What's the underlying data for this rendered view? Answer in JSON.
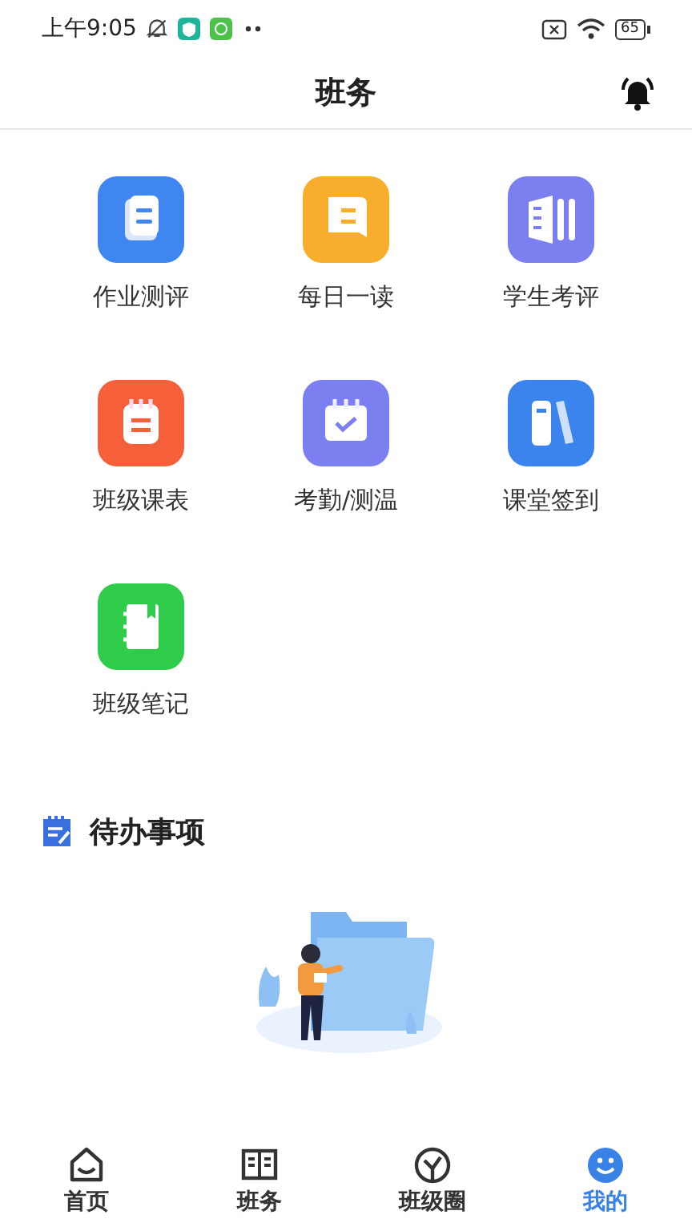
{
  "status_bar": {
    "time": "上午9:05",
    "battery": "65"
  },
  "header": {
    "title": "班务"
  },
  "features": [
    {
      "label": "作业测评",
      "kind": "doc",
      "color": "#3f86f0"
    },
    {
      "label": "每日一读",
      "kind": "book",
      "color": "#f8ad2c"
    },
    {
      "label": "学生考评",
      "kind": "bars",
      "color": "#7b7ff0"
    },
    {
      "label": "班级课表",
      "kind": "calendar",
      "color": "#f5603a"
    },
    {
      "label": "考勤/测温",
      "kind": "check",
      "color": "#7b7ff0"
    },
    {
      "label": "课堂签到",
      "kind": "books",
      "color": "#3b84ee"
    },
    {
      "label": "班级笔记",
      "kind": "notebook",
      "color": "#2fcb4a"
    }
  ],
  "todo": {
    "title": "待办事项"
  },
  "tabs": [
    {
      "label": "首页",
      "kind": "home",
      "selected": false
    },
    {
      "label": "班务",
      "kind": "book",
      "selected": false
    },
    {
      "label": "班级圈",
      "kind": "circle",
      "selected": false
    },
    {
      "label": "我的",
      "kind": "smile",
      "selected": true
    }
  ]
}
